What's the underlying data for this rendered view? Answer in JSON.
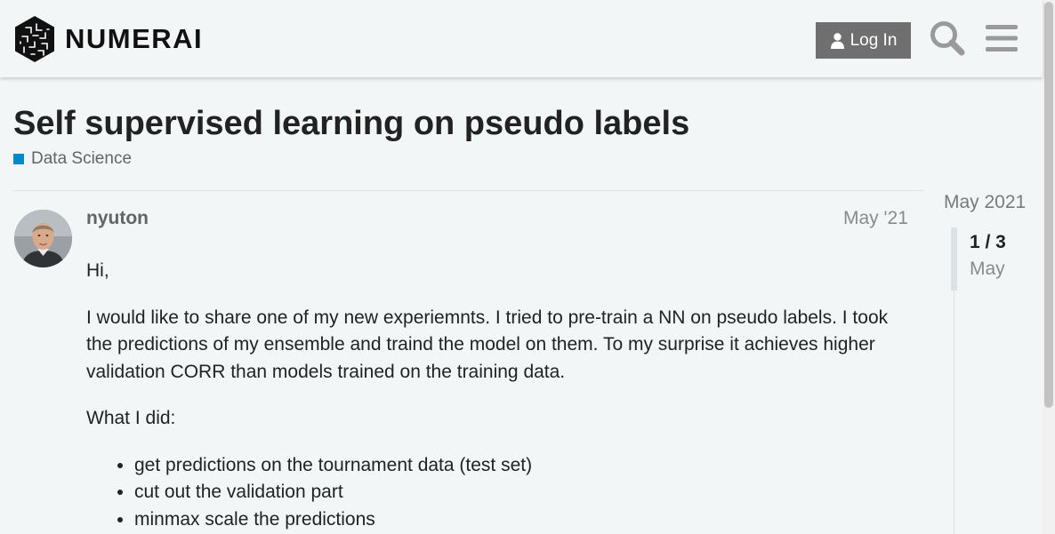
{
  "header": {
    "logo_text": "NUMERAI",
    "login_label": "Log In"
  },
  "topic": {
    "title": "Self supervised learning on pseudo labels",
    "category": "Data Science",
    "category_color": "#0088cc"
  },
  "post": {
    "username": "nyuton",
    "date": "May '21",
    "paragraphs": [
      "Hi,",
      "I would like to share one of my new experiemnts. I tried to pre-train a NN on pseudo labels. I took the predictions of my ensemble and traind the model on them. To my surprise it achieves higher validation CORR than models trained on the training data.",
      "What I did:"
    ],
    "steps": [
      "get predictions on the tournament data (test set)",
      "cut out the validation part",
      "minmax scale the predictions"
    ]
  },
  "timeline": {
    "start_label": "May 2021",
    "position": "1 / 3",
    "current_date": "May"
  },
  "colors": {
    "background": "#f3f6f7",
    "button": "#6f6f6f",
    "accent": "#0088cc"
  },
  "icons": [
    "numerai-logo-icon",
    "user-icon",
    "search-icon",
    "hamburger-menu-icon"
  ]
}
